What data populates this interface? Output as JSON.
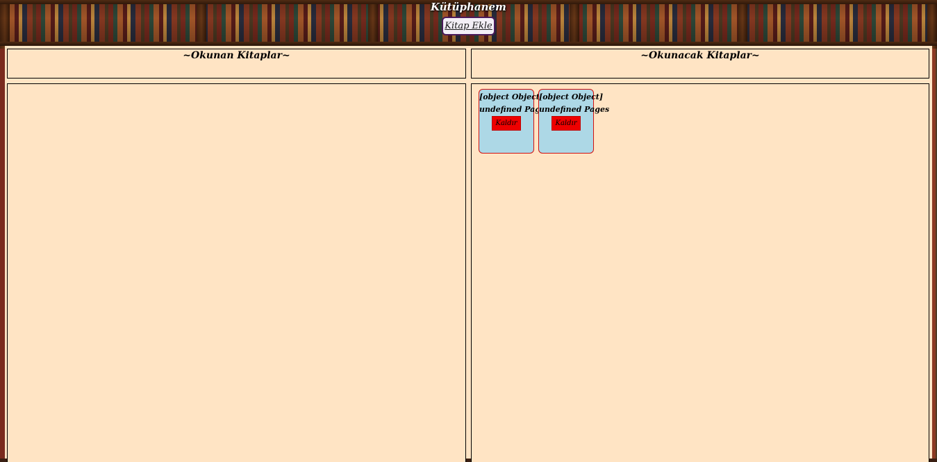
{
  "header": {
    "title": "Kütüphanem",
    "add_book_label": "Kitap Ekle"
  },
  "panels": {
    "read": {
      "title": "~Okunan Kitaplar~",
      "books": []
    },
    "to_read": {
      "title": "~Okunacak Kitaplar~",
      "books": [
        {
          "name": "[object Object]",
          "pages": "undefined Pages",
          "remove_label": "Kaldır"
        },
        {
          "name": "[object Object]",
          "pages": "undefined Pages",
          "remove_label": "Kaldır"
        }
      ]
    }
  },
  "colors": {
    "panel_background": "#ffe4c4",
    "card_background": "#add8e6",
    "card_border": "#d01010",
    "remove_button": "#ee0000"
  }
}
